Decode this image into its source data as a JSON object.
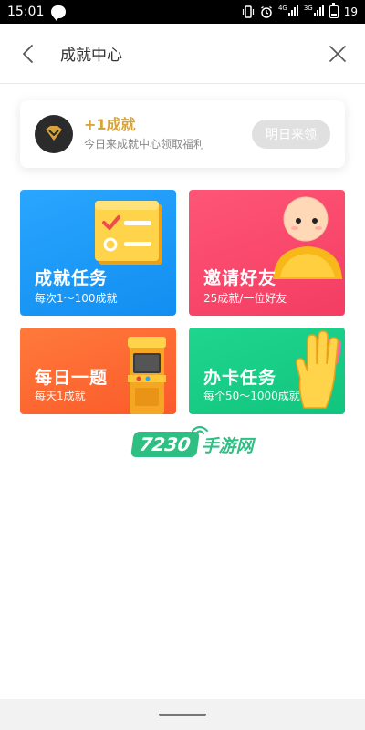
{
  "status_bar": {
    "time": "15:01",
    "network_1": "4G",
    "network_2": "3G",
    "battery_level": "19"
  },
  "header": {
    "title": "成就中心"
  },
  "reward": {
    "title": "+1成就",
    "subtitle": "今日来成就中心领取福利",
    "button_label": "明日来领"
  },
  "tasks": [
    {
      "title": "成就任务",
      "subtitle": "每次1～100成就",
      "color": "#1a9bf8"
    },
    {
      "title": "邀请好友",
      "subtitle": "25成就/一位好友",
      "color": "#f7476a"
    },
    {
      "title": "每日一题",
      "subtitle": "每天1成就",
      "color": "#fd6a30"
    },
    {
      "title": "办卡任务",
      "subtitle": "每个50～1000成就",
      "color": "#18cd86"
    }
  ],
  "watermark": {
    "number": "7230",
    "text": "手游网"
  },
  "colors": {
    "accent_gold": "#d7a43c",
    "watermark_green": "#2fbf83"
  }
}
